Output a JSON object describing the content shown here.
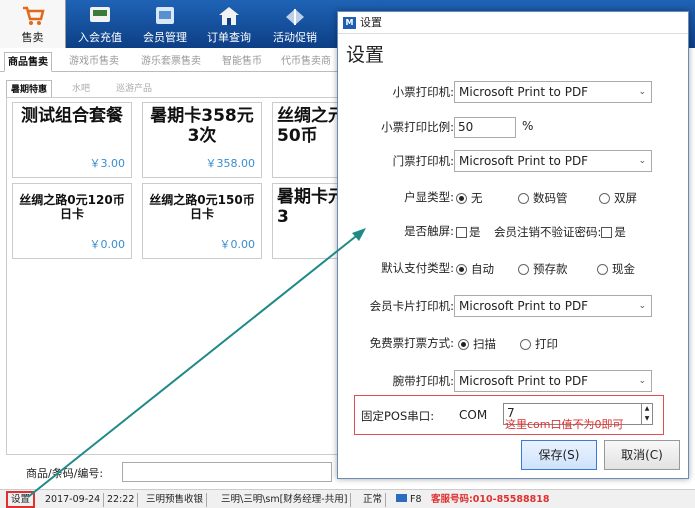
{
  "toolbar": {
    "items": [
      {
        "label": "售卖",
        "icon": "cart-icon"
      },
      {
        "label": "入会充值",
        "icon": "member-card-icon"
      },
      {
        "label": "会员管理",
        "icon": "member-manage-icon"
      },
      {
        "label": "订单查询",
        "icon": "order-icon"
      },
      {
        "label": "活动促销",
        "icon": "promo-icon"
      }
    ]
  },
  "subtabs": [
    "商品售卖",
    "游戏币售卖",
    "游乐套票售卖",
    "智能售币",
    "代币售卖商"
  ],
  "cattabs": [
    "暑期特惠",
    "水吧",
    "巡游产品"
  ],
  "cards": [
    {
      "name": "测试组合套餐",
      "price": "￥3.00"
    },
    {
      "name": "暑期卡358元3次",
      "price": "￥358.00"
    },
    {
      "name": "丝绸之元50币",
      "price": ""
    },
    {
      "name": "丝绸之路0元120币日卡",
      "price": "￥0.00"
    },
    {
      "name": "丝绸之路0元150币日卡",
      "price": "￥0.00"
    },
    {
      "name": "暑期卡元3",
      "price": ""
    }
  ],
  "search": {
    "label": "商品/条码/编号:"
  },
  "status": {
    "settings": "设置",
    "date": "2017-09-24",
    "time": "22:22",
    "venue": "三明预售收银",
    "user": "三明\\三明\\sm[财务经理-共用]",
    "state": "正常",
    "key": "F8",
    "service": "客服号码:010-85588818"
  },
  "dialog": {
    "window_title": "设置",
    "heading": "设置",
    "receipt_printer_label": "小票打印机:",
    "receipt_printer": "Microsoft Print to PDF",
    "receipt_scale_label": "小票打印比例:",
    "receipt_scale": "50",
    "percent": "%",
    "ticket_printer_label": "门票打印机:",
    "ticket_printer": "Microsoft Print to PDF",
    "display_label": "户显类型:",
    "display_options": [
      "无",
      "数码管",
      "双屏"
    ],
    "touch_label": "是否触屏:",
    "touch_yes": "是",
    "member_label": "会员注销不验证密码:",
    "member_yes": "是",
    "pay_label": "默认支付类型:",
    "pay_options": [
      "自动",
      "预存款",
      "现金"
    ],
    "card_printer_label": "会员卡片打印机:",
    "card_printer": "Microsoft Print to PDF",
    "free_label": "免费票打票方式:",
    "free_options": [
      "扫描",
      "打印"
    ],
    "wrist_printer_label": "腕带打印机:",
    "wrist_printer": "Microsoft Print to PDF",
    "pos_label": "固定POS串口:",
    "com": "COM",
    "com_value": "7",
    "note": "这里com口值不为0即可",
    "save": "保存(S)",
    "cancel": "取消(C)"
  }
}
